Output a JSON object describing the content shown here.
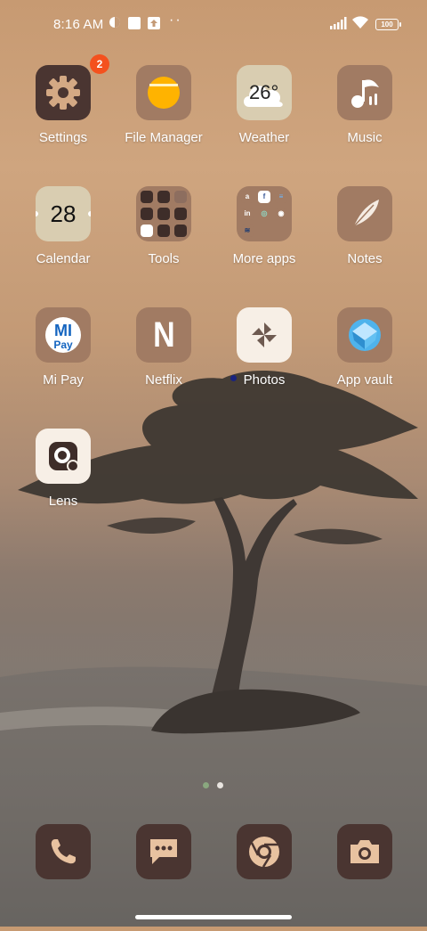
{
  "status_bar": {
    "time": "8:16 AM",
    "battery": "100",
    "overflow": "··"
  },
  "apps": [
    {
      "label": "Settings",
      "badge": "2",
      "icon": "gear-icon"
    },
    {
      "label": "File Manager",
      "icon": "folder-circle-icon"
    },
    {
      "label": "Weather",
      "temp": "26°",
      "icon": "cloud-icon"
    },
    {
      "label": "Music",
      "icon": "music-note-icon"
    },
    {
      "label": "Calendar",
      "date": "28",
      "icon": "calendar-icon"
    },
    {
      "label": "Tools",
      "icon": "tools-folder-icon"
    },
    {
      "label": "More apps",
      "icon": "apps-folder-icon"
    },
    {
      "label": "Notes",
      "icon": "feather-icon"
    },
    {
      "label": "Mi Pay",
      "logo": "MI",
      "logo_sub": "Pay",
      "icon": "mi-pay-icon"
    },
    {
      "label": "Netflix",
      "logo": "N",
      "icon": "netflix-icon"
    },
    {
      "label": "Photos",
      "icon": "pinwheel-icon"
    },
    {
      "label": "App vault",
      "icon": "cube-icon"
    },
    {
      "label": "Lens",
      "icon": "lens-icon"
    }
  ],
  "more_apps_folder": [
    "a",
    "f",
    "≡",
    "in",
    "◎",
    "◉",
    "≋"
  ],
  "dock": [
    {
      "name": "phone",
      "icon": "phone-icon"
    },
    {
      "name": "messages",
      "icon": "message-icon"
    },
    {
      "name": "browser",
      "icon": "chrome-icon"
    },
    {
      "name": "camera",
      "icon": "camera-icon"
    }
  ],
  "colors": {
    "tile_bg": "#a17b63",
    "dock_bg": "#4a3531",
    "badge": "#f4511e",
    "new_app_dot": "#1a237e"
  }
}
